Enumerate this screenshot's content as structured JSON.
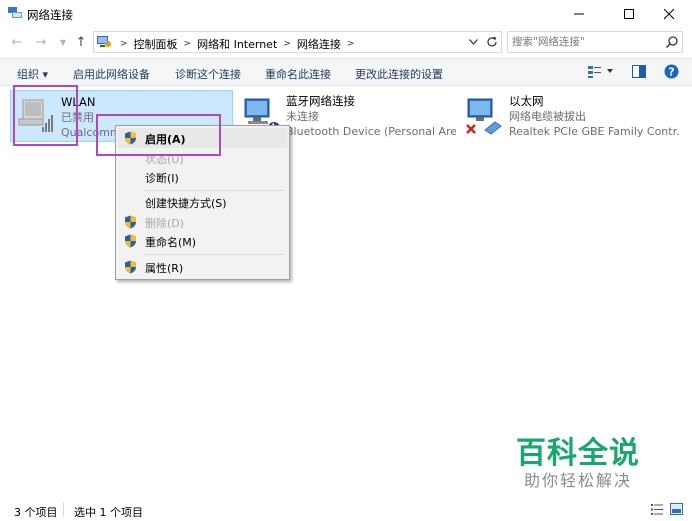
{
  "window": {
    "title": "网络连接",
    "minimize_icon": "minimize-icon",
    "maximize_icon": "maximize-icon",
    "close_icon": "close-icon"
  },
  "address": {
    "crumbs": [
      "控制面板",
      "网络和 Internet",
      "网络连接"
    ],
    "search_placeholder": "搜索\"网络连接\""
  },
  "toolbar": {
    "organize": "组织 ▾",
    "enable_device": "启用此网络设备",
    "diagnose": "诊断这个连接",
    "rename": "重命名此连接",
    "change_settings": "更改此连接的设置"
  },
  "connections": [
    {
      "name": "WLAN",
      "status": "已禁用",
      "device": "Qualcomm",
      "selected": true
    },
    {
      "name": "蓝牙网络连接",
      "status": "未连接",
      "device": "Bluetooth Device (Personal Are...",
      "selected": false
    },
    {
      "name": "以太网",
      "status": "网络电缆被拔出",
      "device": "Realtek PCIe GBE Family Contr...",
      "selected": false
    }
  ],
  "context_menu": {
    "items": [
      {
        "label": "启用(A)",
        "shield": true,
        "disabled": false,
        "highlighted": true
      },
      {
        "label": "状态(U)",
        "shield": false,
        "disabled": true
      },
      {
        "label": "诊断(I)",
        "shield": false,
        "disabled": false
      },
      {
        "label": "创建快捷方式(S)",
        "shield": false,
        "disabled": false
      },
      {
        "label": "删除(D)",
        "shield": true,
        "disabled": true
      },
      {
        "label": "重命名(M)",
        "shield": true,
        "disabled": false
      },
      {
        "label": "属性(R)",
        "shield": true,
        "disabled": false
      }
    ]
  },
  "watermark": {
    "title": "百科全说",
    "subtitle": "助你轻松解决"
  },
  "status": {
    "count": "3 个项目",
    "selected": "选中 1 个项目"
  },
  "colors": {
    "selection_bg": "#cce8ff",
    "highlight_border": "#b146c2",
    "watermark_green": "#17a86b",
    "toolbar_text": "#1e395b"
  }
}
